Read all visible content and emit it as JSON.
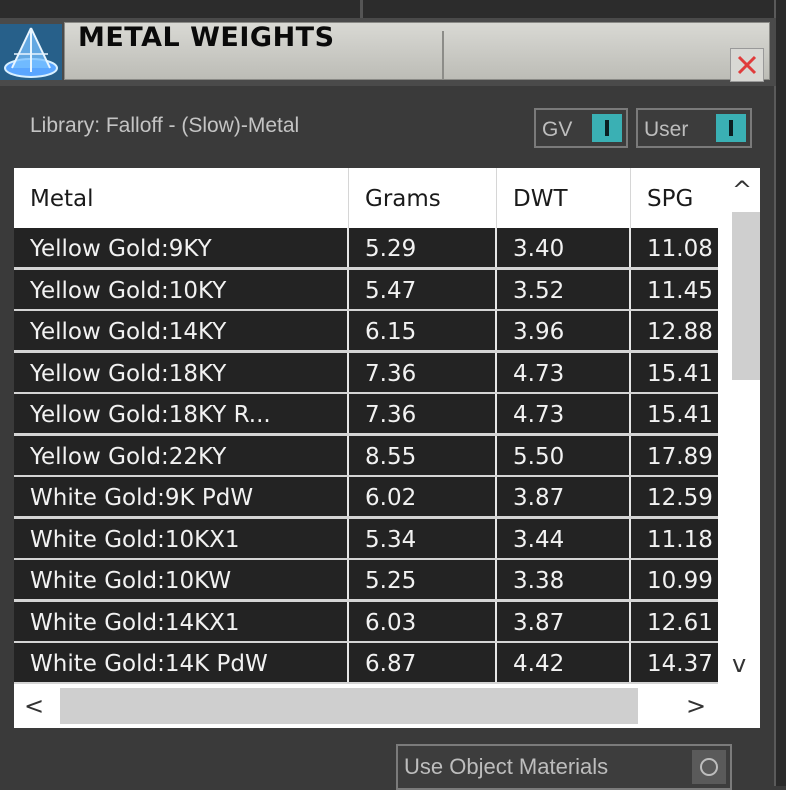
{
  "window": {
    "title": "METAL WEIGHTS"
  },
  "library_label": "Library: Falloff - (Slow)-Metal",
  "toggles": [
    {
      "label": "GV",
      "state": "on"
    },
    {
      "label": "User",
      "state": "on"
    }
  ],
  "table": {
    "columns": [
      "Metal",
      "Grams",
      "DWT",
      "SPG"
    ],
    "rows": [
      [
        "Yellow Gold:9KY",
        "5.29",
        "3.40",
        "11.08"
      ],
      [
        "Yellow Gold:10KY",
        "5.47",
        "3.52",
        "11.45"
      ],
      [
        "Yellow Gold:14KY",
        "6.15",
        "3.96",
        "12.88"
      ],
      [
        "Yellow Gold:18KY",
        "7.36",
        "4.73",
        "15.41"
      ],
      [
        "Yellow Gold:18KY R...",
        "7.36",
        "4.73",
        "15.41"
      ],
      [
        "Yellow Gold:22KY",
        "8.55",
        "5.50",
        "17.89"
      ],
      [
        "White Gold:9K PdW",
        "6.02",
        "3.87",
        "12.59"
      ],
      [
        "White Gold:10KX1",
        "5.34",
        "3.44",
        "11.18"
      ],
      [
        "White Gold:10KW",
        "5.25",
        "3.38",
        "10.99"
      ],
      [
        "White Gold:14KX1",
        "6.03",
        "3.87",
        "12.61"
      ],
      [
        "White Gold:14K PdW",
        "6.87",
        "4.42",
        "14.37"
      ]
    ]
  },
  "scroll": {
    "up_glyph": "^",
    "down_glyph": "v",
    "left_glyph": "<",
    "right_glyph": ">"
  },
  "use_object_materials_label": "Use Object Materials",
  "colors": {
    "accent": "#3ab0b4",
    "close_x": "#e03b3b",
    "row_bg": "#232323"
  }
}
